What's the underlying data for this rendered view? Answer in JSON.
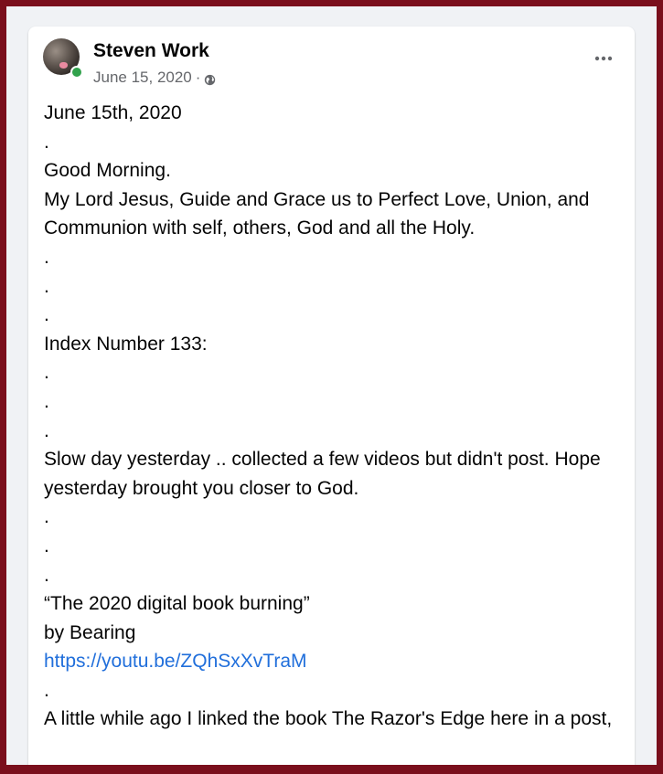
{
  "post": {
    "author": "Steven Work",
    "date": "June 15, 2020",
    "separator": "·",
    "privacy_icon": "globe-icon",
    "more_icon": "more-options-icon",
    "lines": {
      "l1": "June 15th, 2020",
      "l2": ".",
      "l3": "Good Morning.",
      "l4": "My Lord Jesus, Guide and Grace us to Perfect Love, Union, and Communion with self, others, God and all the Holy.",
      "l5": ".",
      "l6": ".",
      "l7": ".",
      "l8": "Index Number 133:",
      "l9": ".",
      "l10": ".",
      "l11": ".",
      "l12": "Slow day yesterday .. collected a few videos but didn't post. Hope yesterday brought you closer to God.",
      "l13": ".",
      "l14": ".",
      "l15": ".",
      "l16": "“The 2020 digital book burning”",
      "l17": "by Bearing",
      "link": "https://youtu.be/ZQhSxXvTraM",
      "l18": ".",
      "l19": "A little while ago I linked the book The Razor's Edge here in a post,"
    }
  },
  "colors": {
    "frame": "#7a0f1c",
    "page_background": "#f0f2f5",
    "link": "#216fdb",
    "online_status": "#31a24c"
  }
}
